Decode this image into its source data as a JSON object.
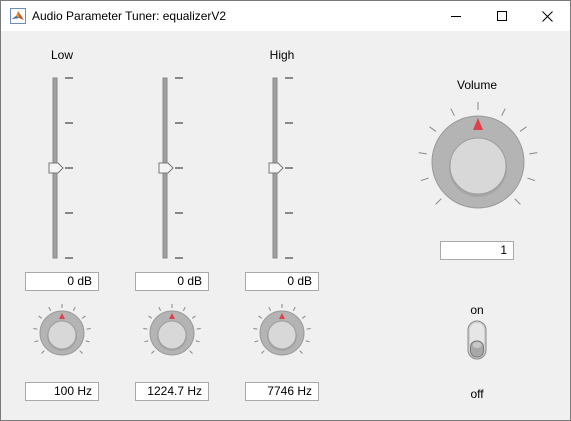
{
  "window": {
    "title": "Audio Parameter Tuner: equalizerV2",
    "controls": [
      "minimize-icon",
      "maximize-icon",
      "close-icon"
    ]
  },
  "bands": [
    {
      "label": "Low",
      "gain": "0 dB",
      "gain_level": 0.5,
      "frequency": "100 Hz"
    },
    {
      "label": "",
      "gain": "0 dB",
      "gain_level": 0.5,
      "frequency": "1224.7 Hz"
    },
    {
      "label": "High",
      "gain": "0 dB",
      "gain_level": 0.5,
      "frequency": "7746 Hz"
    }
  ],
  "volume": {
    "label": "Volume",
    "value": "1"
  },
  "switch": {
    "on_label": "on",
    "off_label": "off",
    "state": "off"
  },
  "colors": {
    "pointer": "#e0404a",
    "knob_ring": "#b4b4b4",
    "knob_cap": "#d8d8d8"
  }
}
